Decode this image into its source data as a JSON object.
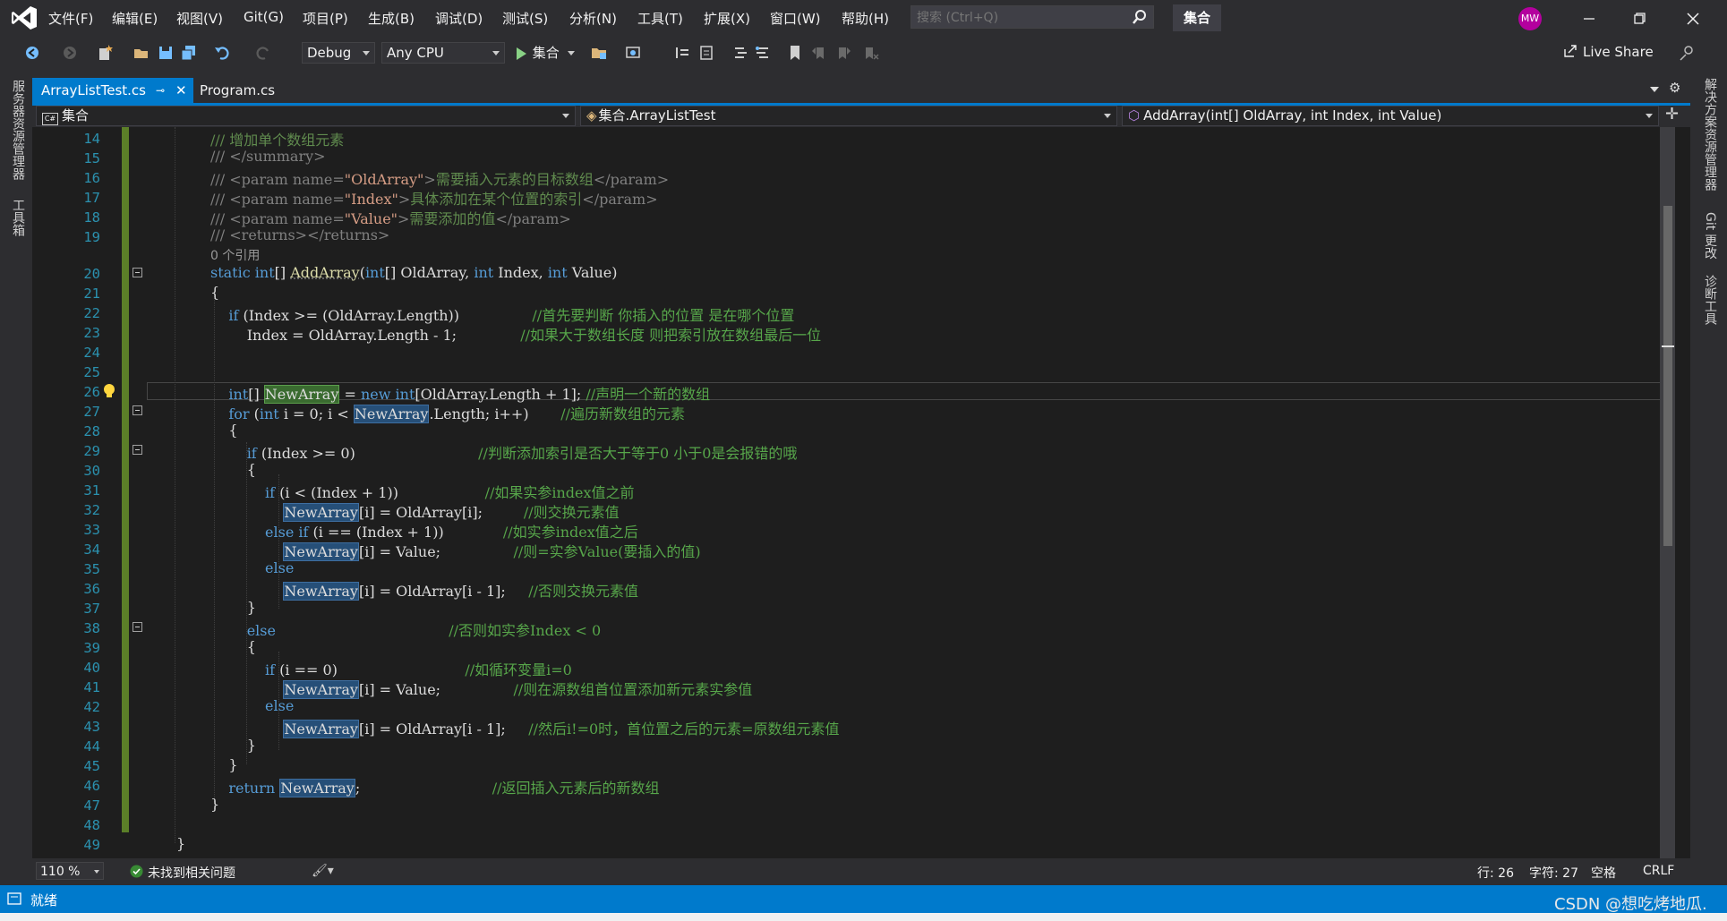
{
  "menubar": {
    "items": [
      "文件(F)",
      "编辑(E)",
      "视图(V)",
      "Git(G)",
      "项目(P)",
      "生成(B)",
      "调试(D)",
      "测试(S)",
      "分析(N)",
      "工具(T)",
      "扩展(X)",
      "窗口(W)",
      "帮助(H)"
    ],
    "search_placeholder": "搜索 (Ctrl+Q)",
    "solution_name": "集合",
    "avatar_initials": "MW",
    "avatar_color": "#b4009e"
  },
  "toolbar": {
    "config": "Debug",
    "platform": "Any CPU",
    "run_label": "集合",
    "live_share": "Live Share"
  },
  "side": {
    "left_items": [
      "服务器资源管理器",
      "工具箱"
    ],
    "right_items": [
      "解决方案资源管理器",
      "Git 更改",
      "诊断工具"
    ]
  },
  "tabs": [
    {
      "label": "ArrayListTest.cs",
      "active": true
    },
    {
      "label": "Program.cs",
      "active": false
    }
  ],
  "navbar": {
    "project": "集合",
    "type": "集合.ArrayListTest",
    "member": "AddArray(int[] OldArray, int Index, int Value)"
  },
  "editor": {
    "line_numbers": [
      "14",
      "15",
      "16",
      "17",
      "18",
      "19",
      "20",
      "21",
      "22",
      "23",
      "24",
      "25",
      "26",
      "27",
      "28",
      "29",
      "30",
      "31",
      "32",
      "33",
      "34",
      "35",
      "36",
      "37",
      "38",
      "39",
      "40",
      "41",
      "42",
      "43",
      "44",
      "45",
      "46",
      "47",
      "48",
      "49"
    ],
    "codelens": "0 个引用",
    "comments": {
      "c14": "/// 增加单个数组元素",
      "c15": "/// </summary>",
      "c22": "//首先要判断 你插入的位置 是在哪个位置",
      "c23": "//如果大于数组长度 则把索引放在数组最后一位",
      "c26": "//声明一个新的数组",
      "c27": "//遍历新数组的元素",
      "c29": "//判断添加索引是否大于等于0 小于0是会报错的哦",
      "c31": "//如果实参index值之前",
      "c32": "//则交换元素值",
      "c33": "//如实参index值之后",
      "c34": "//则=实参Value(要插入的值)",
      "c36": "//否则交换元素值",
      "c38": "//否则如实参Index < 0",
      "c40": "//如循环变量i=0",
      "c41": "//则在源数组首位置添加新元素实参值",
      "c43": "//然后i!=0时，首位置之后的元素=原数组元素值",
      "c46": "//返回插入元素后的新数组"
    },
    "xmldoc": {
      "p16_desc": "需要插入元素的目标数组",
      "p17_desc": "具体添加在某个位置的索引",
      "p18_desc": "需要添加的值"
    }
  },
  "editor_status": {
    "zoom": "110 %",
    "issues": "未找到相关问题",
    "line": "行: 26",
    "char": "字符: 27",
    "whitespace": "空格",
    "eol": "CRLF"
  },
  "app_status": {
    "ready": "就绪",
    "watermark": "CSDN @想吃烤地瓜."
  }
}
